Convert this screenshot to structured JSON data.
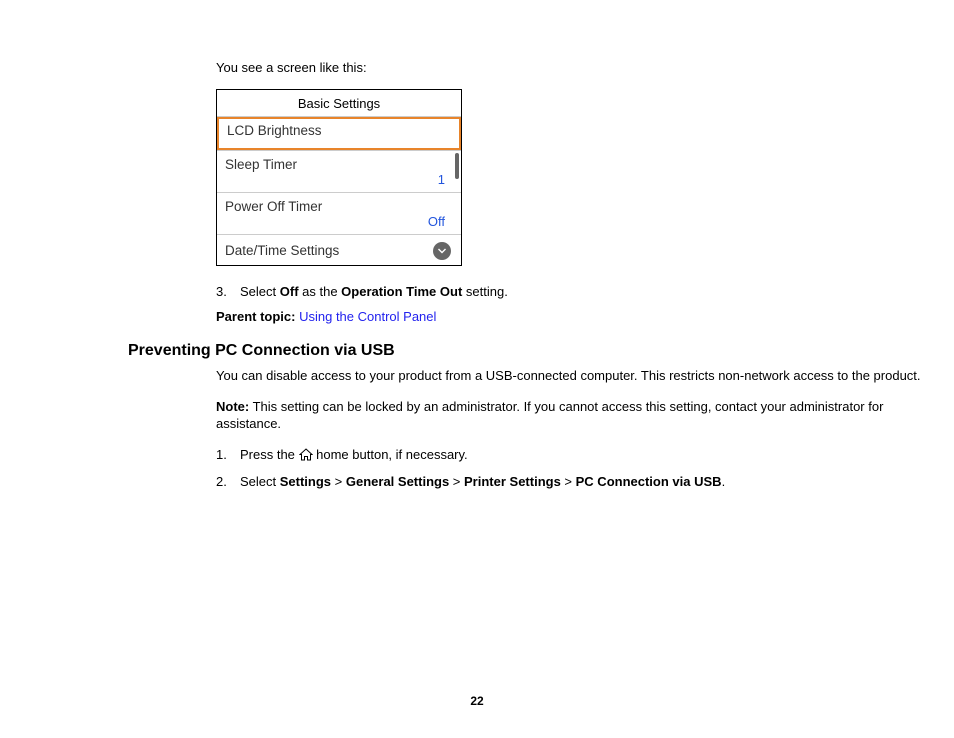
{
  "intro": "You see a screen like this:",
  "screen": {
    "title": "Basic Settings",
    "items": [
      {
        "label": "LCD Brightness",
        "value": ""
      },
      {
        "label": "Sleep Timer",
        "value": "1"
      },
      {
        "label": "Power Off Timer",
        "value": "Off"
      },
      {
        "label": "Date/Time Settings",
        "value": ""
      }
    ]
  },
  "step3": {
    "num": "3.",
    "pre": "Select ",
    "bold1": "Off",
    "mid": " as the ",
    "bold2": "Operation Time Out",
    "post": " setting."
  },
  "parentTopic": {
    "label": "Parent topic:",
    "link": "Using the Control Panel"
  },
  "heading": "Preventing PC Connection via USB",
  "para1": "You can disable access to your product from a USB-connected computer. This restricts non-network access to the product.",
  "noteLabel": "Note:",
  "noteText": " This setting can be locked by an administrator. If you cannot access this setting, contact your administrator for assistance.",
  "step1": {
    "num": "1.",
    "pre": "Press the ",
    "post": " home button, if necessary."
  },
  "step2": {
    "num": "2.",
    "pre": "Select ",
    "b1": "Settings",
    "s1": " > ",
    "b2": "General Settings",
    "s2": " > ",
    "b3": "Printer Settings",
    "s3": " > ",
    "b4": "PC Connection via USB",
    "post": "."
  },
  "pageNumber": "22"
}
